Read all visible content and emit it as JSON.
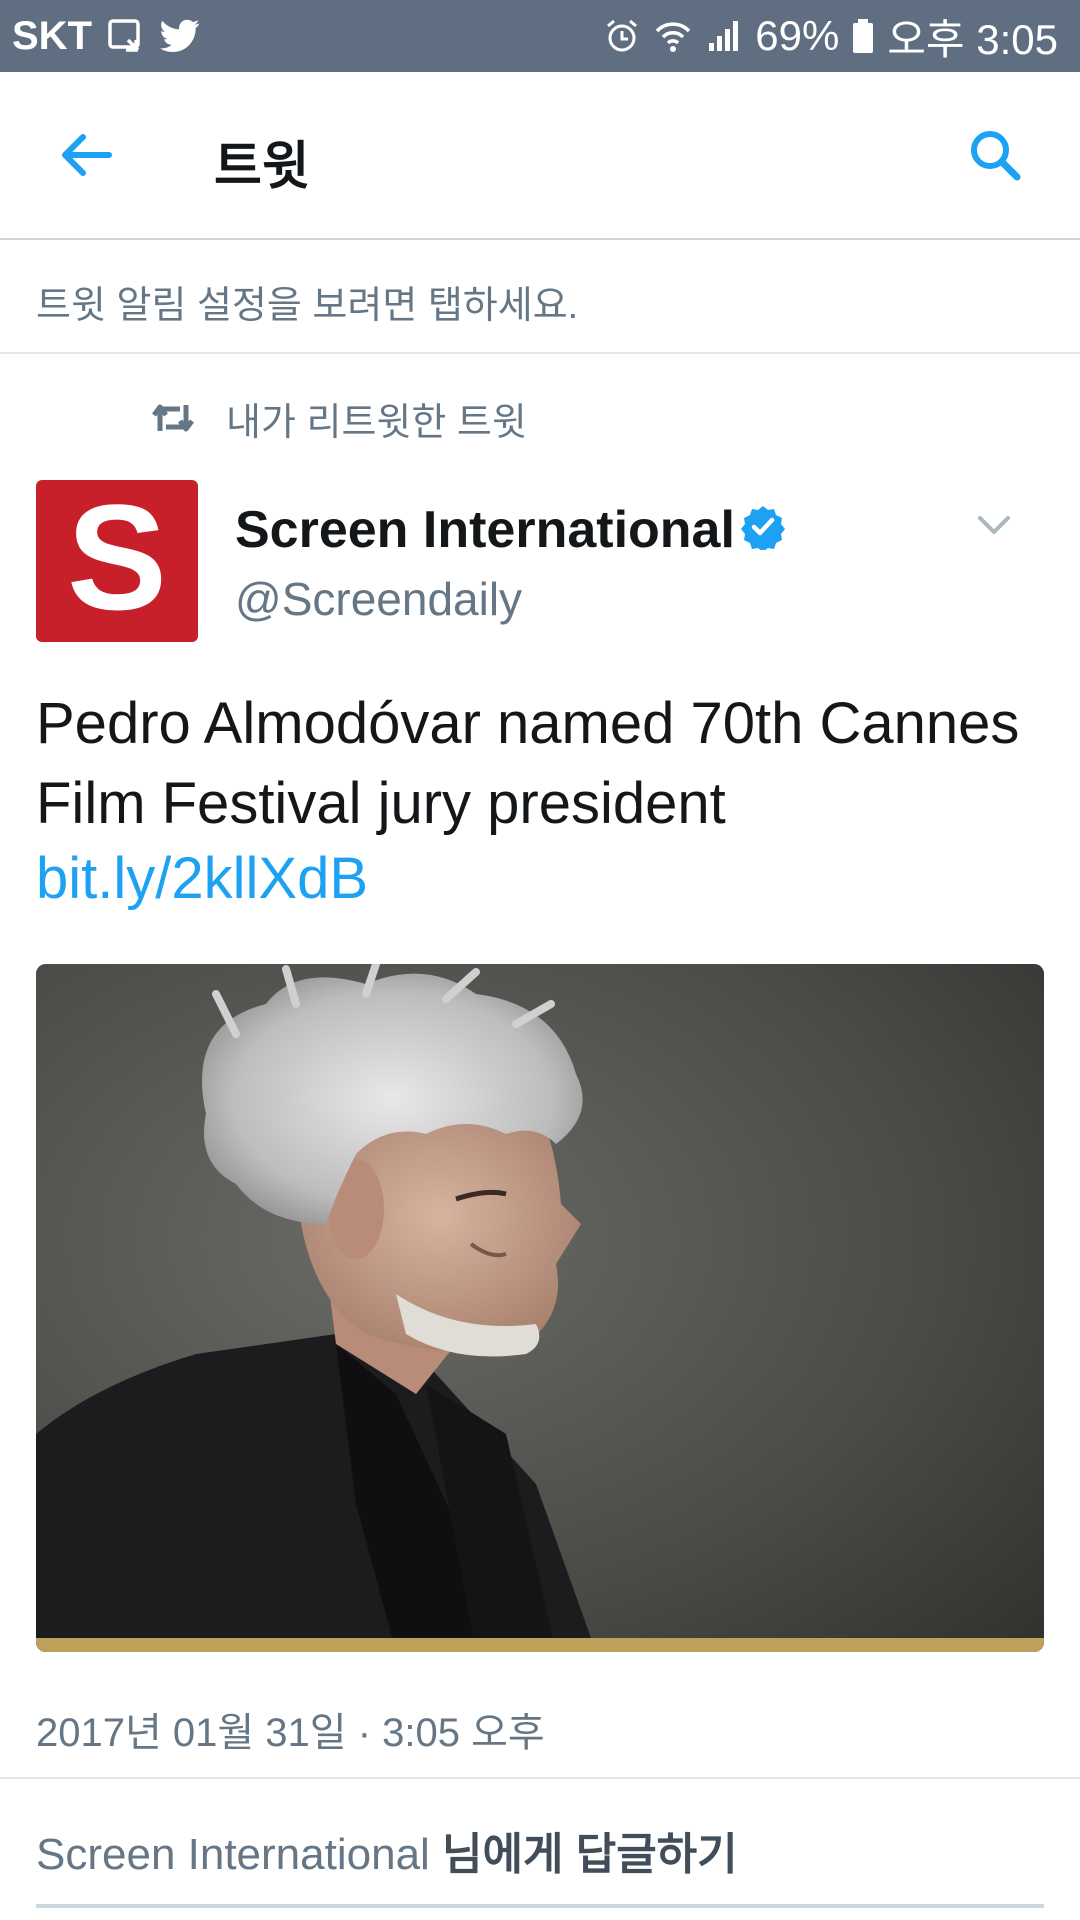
{
  "status_bar": {
    "carrier": "SKT",
    "battery": "69%",
    "time": "오후 3:05"
  },
  "toolbar": {
    "title": "트윗"
  },
  "notification_hint": "트윗 알림 설정을 보려면 탭하세요.",
  "retweet_context": "내가 리트윗한 트윗",
  "tweet": {
    "avatar_letter": "S",
    "display_name": "Screen International",
    "handle": "@Screendaily",
    "text": "Pedro Almodóvar named 70th Cannes Film Festival jury president",
    "link": "bit.ly/2kllXdB",
    "timestamp": "2017년 01월 31일 · 3:05 오후"
  },
  "reply": {
    "name": "Screen International",
    "suffix": "님에게 답글하기"
  },
  "colors": {
    "status_bar": "#5f6f81",
    "accent": "#1da1f2",
    "avatar_bg": "#c8202a",
    "secondary_text": "#657786"
  }
}
